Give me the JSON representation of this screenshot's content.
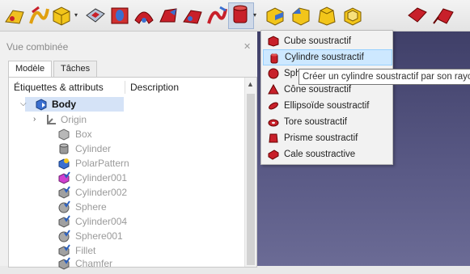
{
  "panel": {
    "title": "Vue combinée",
    "tabs": [
      "Modèle",
      "Tâches"
    ],
    "columns": [
      "Étiquettes & attributs",
      "Description"
    ]
  },
  "tree": {
    "body": "Body",
    "items": [
      "Origin",
      "Box",
      "Cylinder",
      "PolarPattern",
      "Cylinder001",
      "Cylinder002",
      "Sphere",
      "Cylinder004",
      "Sphere001",
      "Fillet",
      "Chamfer"
    ]
  },
  "menu": {
    "items": [
      "Cube soustractif",
      "Cylindre soustractif",
      "Sphère soustractive",
      "Cône soustractif",
      "Ellipsoïde soustractif",
      "Tore soustractif",
      "Prisme soustractif",
      "Cale soustractive"
    ],
    "highlighted_index": 1
  },
  "tooltip": "Créer un cylindre soustractif par son rayon",
  "colors": {
    "view_top": "#3f3f68",
    "view_bottom": "#6b6b95",
    "selection": "#d5e3f7",
    "menu_highlight": "#cde8ff",
    "subtractive_red": "#c8202a"
  },
  "icons": {
    "toolbar": [
      "additive-pipe-icon",
      "additive-helix-icon",
      "additive-primitive-icon",
      "subtractive-pad-icon",
      "pocket-icon",
      "hole-icon",
      "groove-icon",
      "subtractive-loft-icon",
      "subtractive-pipe-icon",
      "subtractive-primitive-icon",
      "fillet-icon",
      "chamfer-icon",
      "draft-icon",
      "thickness-icon",
      "mirrored-icon",
      "linear-pattern-icon"
    ]
  }
}
